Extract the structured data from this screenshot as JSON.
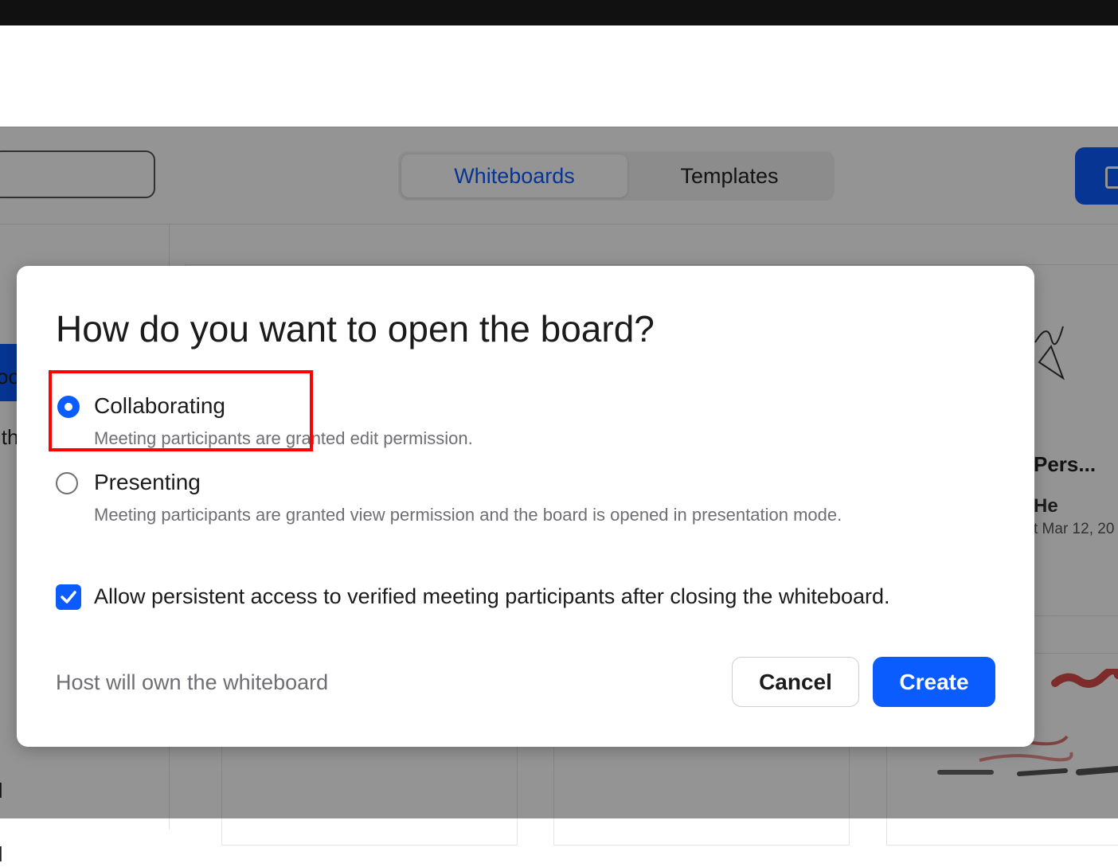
{
  "background": {
    "tabs": [
      {
        "label": "Whiteboards",
        "active": true
      },
      {
        "label": "Templates",
        "active": false
      }
    ],
    "sidebar_fragments": [
      "oo",
      "ith",
      "ll",
      "ll"
    ],
    "card": {
      "title_fragment": "Pers...",
      "owner_fragment": "He",
      "date_fragment": "t Mar 12, 20"
    }
  },
  "dialog": {
    "title": "How do you want to open the board?",
    "options": [
      {
        "label": "Collaborating",
        "description": "Meeting participants are granted edit permission.",
        "selected": true
      },
      {
        "label": "Presenting",
        "description": "Meeting participants are granted view permission and the board is opened in presentation mode.",
        "selected": false
      }
    ],
    "persistent_access": {
      "label": "Allow persistent access to verified meeting participants after closing the whiteboard.",
      "checked": true
    },
    "footnote": "Host will own the whiteboard",
    "cancel_label": "Cancel",
    "create_label": "Create"
  },
  "colors": {
    "accent": "#0b5cff",
    "highlight": "#ff0000",
    "overlay": "rgba(0,0,0,0.42)"
  }
}
